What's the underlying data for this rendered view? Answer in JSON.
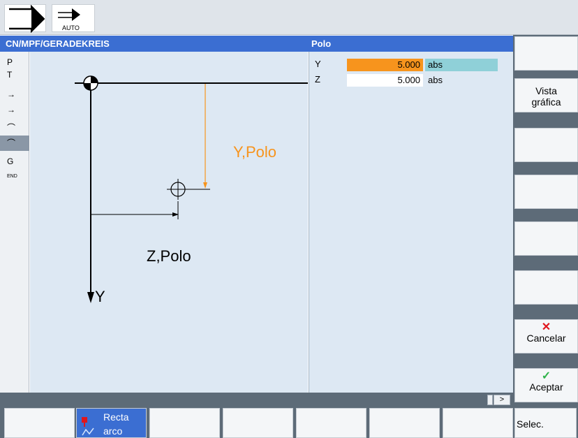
{
  "top_bar": {
    "auto_label": "AUTO"
  },
  "header": {
    "path": "CN/MPF/GERADEKREIS",
    "section": "Polo"
  },
  "left_strip": {
    "items": [
      "P",
      "T",
      "→",
      "→",
      "⌒",
      "⌒",
      "G",
      "END"
    ],
    "selected_index": 5
  },
  "graphic": {
    "y_polo_label": "Y,Polo",
    "z_polo_label": "Z,Polo",
    "y_axis_label": "Y"
  },
  "params": {
    "rows": [
      {
        "label": "Y",
        "value": "5.000",
        "unit": "abs"
      },
      {
        "label": "Z",
        "value": "5.000",
        "unit": "abs"
      }
    ]
  },
  "status": {
    "more": ">"
  },
  "vertical_softkeys": [
    {
      "label": ""
    },
    {
      "label_line1": "Vista",
      "label_line2": "gráfica"
    },
    {
      "label": ""
    },
    {
      "label": ""
    },
    {
      "label": ""
    },
    {
      "label": ""
    },
    {
      "label": "Cancelar",
      "icon": "cross-icon"
    },
    {
      "label": "Aceptar",
      "icon": "check-icon"
    }
  ],
  "horizontal_softkeys": [
    {
      "label": ""
    },
    {
      "label_line1": "Recta",
      "label_line2": "arco",
      "icon": "contour-icon"
    },
    {
      "label": ""
    },
    {
      "label": ""
    },
    {
      "label": ""
    },
    {
      "label": ""
    },
    {
      "label": ""
    },
    {
      "label": "Selec."
    }
  ],
  "colors": {
    "header": "#3b6ed2",
    "panel": "#dde8f3",
    "active_field": "#f7941d",
    "unit_highlight": "#8fd0d8",
    "polo_line": "#f7941d"
  }
}
